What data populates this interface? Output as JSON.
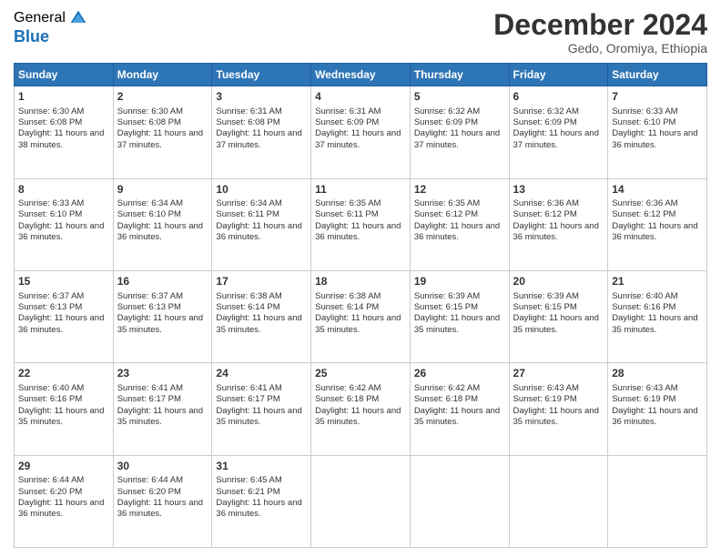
{
  "logo": {
    "general": "General",
    "blue": "Blue"
  },
  "title": "December 2024",
  "subtitle": "Gedo, Oromiya, Ethiopia",
  "days": [
    "Sunday",
    "Monday",
    "Tuesday",
    "Wednesday",
    "Thursday",
    "Friday",
    "Saturday"
  ],
  "weeks": [
    [
      {
        "num": "1",
        "sunrise": "6:30 AM",
        "sunset": "6:08 PM",
        "daylight": "11 hours and 38 minutes."
      },
      {
        "num": "2",
        "sunrise": "6:30 AM",
        "sunset": "6:08 PM",
        "daylight": "11 hours and 37 minutes."
      },
      {
        "num": "3",
        "sunrise": "6:31 AM",
        "sunset": "6:08 PM",
        "daylight": "11 hours and 37 minutes."
      },
      {
        "num": "4",
        "sunrise": "6:31 AM",
        "sunset": "6:09 PM",
        "daylight": "11 hours and 37 minutes."
      },
      {
        "num": "5",
        "sunrise": "6:32 AM",
        "sunset": "6:09 PM",
        "daylight": "11 hours and 37 minutes."
      },
      {
        "num": "6",
        "sunrise": "6:32 AM",
        "sunset": "6:09 PM",
        "daylight": "11 hours and 37 minutes."
      },
      {
        "num": "7",
        "sunrise": "6:33 AM",
        "sunset": "6:10 PM",
        "daylight": "11 hours and 36 minutes."
      }
    ],
    [
      {
        "num": "8",
        "sunrise": "6:33 AM",
        "sunset": "6:10 PM",
        "daylight": "11 hours and 36 minutes."
      },
      {
        "num": "9",
        "sunrise": "6:34 AM",
        "sunset": "6:10 PM",
        "daylight": "11 hours and 36 minutes."
      },
      {
        "num": "10",
        "sunrise": "6:34 AM",
        "sunset": "6:11 PM",
        "daylight": "11 hours and 36 minutes."
      },
      {
        "num": "11",
        "sunrise": "6:35 AM",
        "sunset": "6:11 PM",
        "daylight": "11 hours and 36 minutes."
      },
      {
        "num": "12",
        "sunrise": "6:35 AM",
        "sunset": "6:12 PM",
        "daylight": "11 hours and 36 minutes."
      },
      {
        "num": "13",
        "sunrise": "6:36 AM",
        "sunset": "6:12 PM",
        "daylight": "11 hours and 36 minutes."
      },
      {
        "num": "14",
        "sunrise": "6:36 AM",
        "sunset": "6:12 PM",
        "daylight": "11 hours and 36 minutes."
      }
    ],
    [
      {
        "num": "15",
        "sunrise": "6:37 AM",
        "sunset": "6:13 PM",
        "daylight": "11 hours and 36 minutes."
      },
      {
        "num": "16",
        "sunrise": "6:37 AM",
        "sunset": "6:13 PM",
        "daylight": "11 hours and 35 minutes."
      },
      {
        "num": "17",
        "sunrise": "6:38 AM",
        "sunset": "6:14 PM",
        "daylight": "11 hours and 35 minutes."
      },
      {
        "num": "18",
        "sunrise": "6:38 AM",
        "sunset": "6:14 PM",
        "daylight": "11 hours and 35 minutes."
      },
      {
        "num": "19",
        "sunrise": "6:39 AM",
        "sunset": "6:15 PM",
        "daylight": "11 hours and 35 minutes."
      },
      {
        "num": "20",
        "sunrise": "6:39 AM",
        "sunset": "6:15 PM",
        "daylight": "11 hours and 35 minutes."
      },
      {
        "num": "21",
        "sunrise": "6:40 AM",
        "sunset": "6:16 PM",
        "daylight": "11 hours and 35 minutes."
      }
    ],
    [
      {
        "num": "22",
        "sunrise": "6:40 AM",
        "sunset": "6:16 PM",
        "daylight": "11 hours and 35 minutes."
      },
      {
        "num": "23",
        "sunrise": "6:41 AM",
        "sunset": "6:17 PM",
        "daylight": "11 hours and 35 minutes."
      },
      {
        "num": "24",
        "sunrise": "6:41 AM",
        "sunset": "6:17 PM",
        "daylight": "11 hours and 35 minutes."
      },
      {
        "num": "25",
        "sunrise": "6:42 AM",
        "sunset": "6:18 PM",
        "daylight": "11 hours and 35 minutes."
      },
      {
        "num": "26",
        "sunrise": "6:42 AM",
        "sunset": "6:18 PM",
        "daylight": "11 hours and 35 minutes."
      },
      {
        "num": "27",
        "sunrise": "6:43 AM",
        "sunset": "6:19 PM",
        "daylight": "11 hours and 35 minutes."
      },
      {
        "num": "28",
        "sunrise": "6:43 AM",
        "sunset": "6:19 PM",
        "daylight": "11 hours and 36 minutes."
      }
    ],
    [
      {
        "num": "29",
        "sunrise": "6:44 AM",
        "sunset": "6:20 PM",
        "daylight": "11 hours and 36 minutes."
      },
      {
        "num": "30",
        "sunrise": "6:44 AM",
        "sunset": "6:20 PM",
        "daylight": "11 hours and 36 minutes."
      },
      {
        "num": "31",
        "sunrise": "6:45 AM",
        "sunset": "6:21 PM",
        "daylight": "11 hours and 36 minutes."
      },
      null,
      null,
      null,
      null
    ]
  ]
}
